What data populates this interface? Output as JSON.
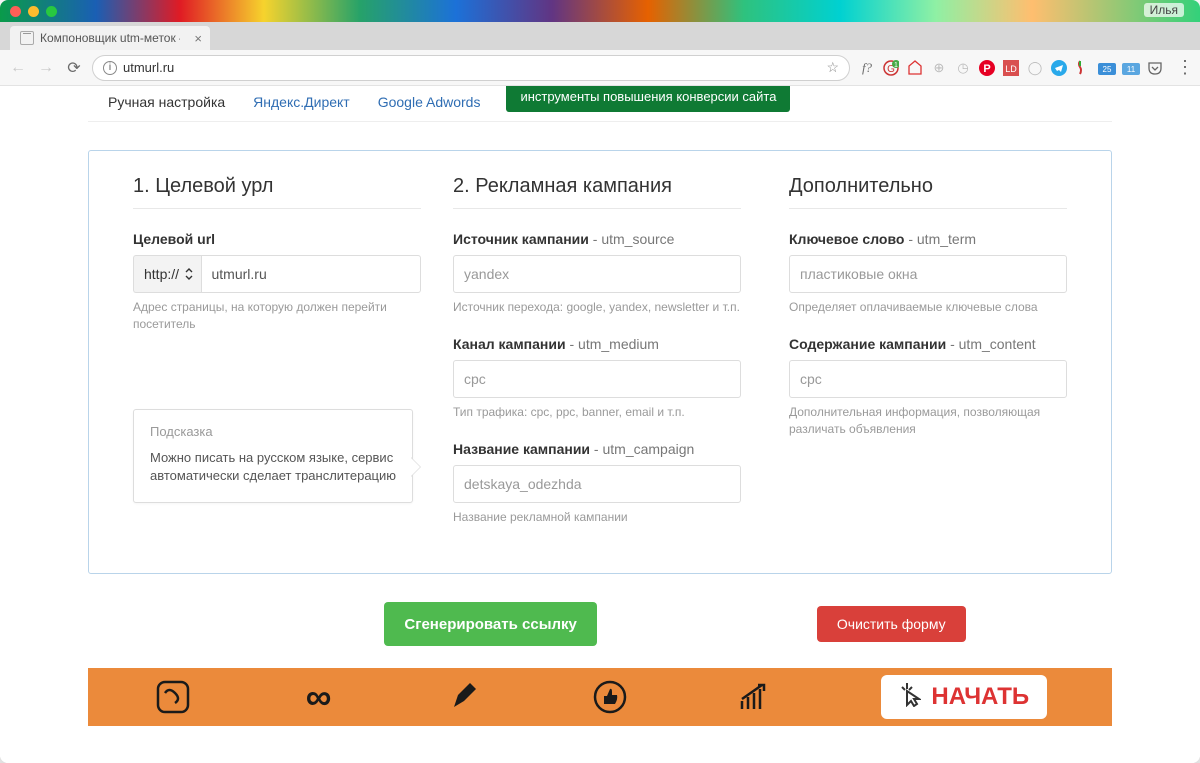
{
  "browser": {
    "user_label": "Илья",
    "tab_title": "Компоновщик utm-меток — г",
    "url": "utmurl.ru"
  },
  "mode_tabs": {
    "manual": "Ручная настройка",
    "yandex": "Яндекс.Директ",
    "adwords": "Google Adwords",
    "cta": "инструменты повышения конверсии сайта"
  },
  "section1": {
    "title": "1. Целевой урл",
    "url_label": "Целевой url",
    "protocol": "http://",
    "url_value": "utmurl.ru",
    "url_hint": "Адрес страницы, на которую должен перейти посетитель"
  },
  "tooltip": {
    "title": "Подсказка",
    "body": "Можно писать на русском языке, сервис автоматически сделает транслитерацию"
  },
  "section2": {
    "title": "2. Рекламная кампания",
    "source_label": "Источник кампании",
    "source_param": " - utm_source",
    "source_placeholder": "yandex",
    "source_hint": "Источник перехода: google, yandex, newsletter и т.п.",
    "medium_label": "Канал кампании",
    "medium_param": " - utm_medium",
    "medium_placeholder": "cpc",
    "medium_hint": "Тип трафика: cpc, ppc, banner, email и т.п.",
    "campaign_label": "Название кампании",
    "campaign_param": " - utm_campaign",
    "campaign_placeholder": "detskaya_odezhda",
    "campaign_hint": "Название рекламной кампании"
  },
  "section3": {
    "title": "Дополнительно",
    "term_label": "Ключевое слово",
    "term_param": " - utm_term",
    "term_placeholder": "пластиковые окна",
    "term_hint": "Определяет оплачиваемые ключевые слова",
    "content_label": "Содержание кампании",
    "content_param": " - utm_content",
    "content_placeholder": "cpc",
    "content_hint": "Дополнительная информация, позволяющая различать объявления"
  },
  "actions": {
    "generate": "Сгенерировать ссылку",
    "clear": "Очистить форму"
  },
  "banner": {
    "start": "НАЧАТЬ",
    "infinity": "∞"
  }
}
